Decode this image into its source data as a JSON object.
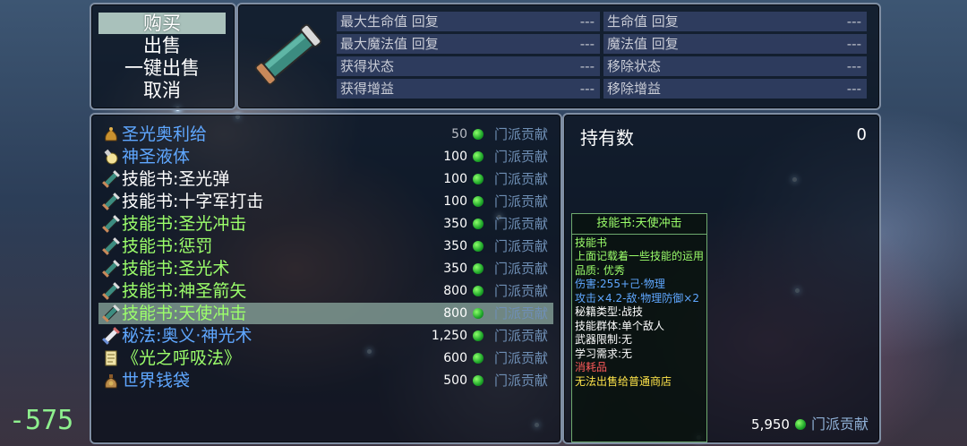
{
  "menu": {
    "items": [
      "购买",
      "出售",
      "一键出售",
      "取消"
    ],
    "selected_index": 0
  },
  "item_info": {
    "icon": "scroll-icon",
    "stats": [
      {
        "label": "最大生命值 回复",
        "value": "---"
      },
      {
        "label": "生命值 回复",
        "value": "---"
      },
      {
        "label": "最大魔法值 回复",
        "value": "---"
      },
      {
        "label": "魔法值 回复",
        "value": "---"
      },
      {
        "label": "获得状态",
        "value": "---"
      },
      {
        "label": "移除状态",
        "value": "---"
      },
      {
        "label": "获得增益",
        "value": "---"
      },
      {
        "label": "移除增益",
        "value": "---"
      }
    ]
  },
  "shop": {
    "currency": "门派贡献",
    "items": [
      {
        "name": "圣光奥利给",
        "price": "50",
        "color": "blue",
        "icon": "pouch-icon"
      },
      {
        "name": "神圣液体",
        "price": "100",
        "color": "blue",
        "icon": "potion-icon"
      },
      {
        "name": "技能书:圣光弹",
        "price": "100",
        "color": "white",
        "icon": "skillbook-icon"
      },
      {
        "name": "技能书:十字军打击",
        "price": "100",
        "color": "white",
        "icon": "skillbook-icon"
      },
      {
        "name": "技能书:圣光冲击",
        "price": "350",
        "color": "green",
        "icon": "skillbook-icon"
      },
      {
        "name": "技能书:惩罚",
        "price": "350",
        "color": "green",
        "icon": "skillbook-icon"
      },
      {
        "name": "技能书:圣光术",
        "price": "350",
        "color": "green",
        "icon": "skillbook-icon"
      },
      {
        "name": "技能书:神圣箭矢",
        "price": "800",
        "color": "green",
        "icon": "skillbook-icon"
      },
      {
        "name": "技能书:天使冲击",
        "price": "800",
        "color": "green",
        "icon": "skillbook-icon"
      },
      {
        "name": "秘法:奥义·神光术",
        "price": "1,250",
        "color": "blue",
        "icon": "secret-scroll-icon"
      },
      {
        "name": "《光之呼吸法》",
        "price": "600",
        "color": "green",
        "icon": "manual-icon"
      },
      {
        "name": "世界钱袋",
        "price": "500",
        "color": "blue",
        "icon": "money-bag-icon"
      }
    ],
    "selected_index": 8
  },
  "holding": {
    "label": "持有数",
    "value": "0"
  },
  "tooltip": {
    "title": "技能书:天使冲击",
    "lines": [
      {
        "text": "技能书",
        "color": "green"
      },
      {
        "text": "上面记载着一些技能的运用",
        "color": "green"
      },
      {
        "text": "品质: 优秀",
        "color": "green"
      },
      {
        "text": "伤害:255+己·物理",
        "color": "blue"
      },
      {
        "text": "攻击×4.2-敌·物理防御×2",
        "color": "blue"
      },
      {
        "text": "秘籍类型:战技",
        "color": "white"
      },
      {
        "text": "技能群体:单个敌人",
        "color": "white"
      },
      {
        "text": "武器限制:无",
        "color": "white"
      },
      {
        "text": "学习需求:无",
        "color": "white"
      },
      {
        "text": "消耗品",
        "color": "red"
      },
      {
        "text": "无法出售给普通商店",
        "color": "yellow"
      }
    ]
  },
  "money": {
    "amount": "5,950",
    "currency": "门派贡献"
  },
  "counter": "-575"
}
